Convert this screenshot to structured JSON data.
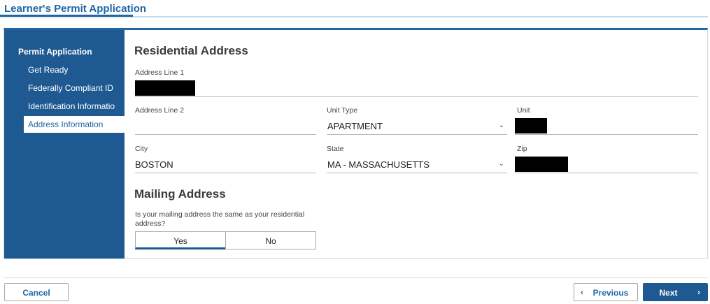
{
  "header": {
    "title": "Learner's Permit Application"
  },
  "sidebar": {
    "heading": "Permit Application",
    "items": [
      {
        "label": "Get Ready"
      },
      {
        "label": "Federally Compliant ID"
      },
      {
        "label": "Identification Information"
      },
      {
        "label": "Address Information"
      }
    ]
  },
  "residential": {
    "title": "Residential Address",
    "address_line1_label": "Address Line 1",
    "address_line2_label": "Address Line 2",
    "address_line2_value": "",
    "unit_type_label": "Unit Type",
    "unit_type_value": "APARTMENT",
    "unit_label": "Unit",
    "city_label": "City",
    "city_value": "BOSTON",
    "state_label": "State",
    "state_value": "MA - MASSACHUSETTS",
    "zip_label": "Zip"
  },
  "mailing": {
    "title": "Mailing Address",
    "question": "Is your mailing address the same as your residential address?",
    "yes_label": "Yes",
    "no_label": "No",
    "selected": "Yes"
  },
  "footer": {
    "cancel_label": "Cancel",
    "previous_label": "Previous",
    "next_label": "Next"
  },
  "colors": {
    "brand": "#1e5a91",
    "accent": "#1f66a5"
  }
}
